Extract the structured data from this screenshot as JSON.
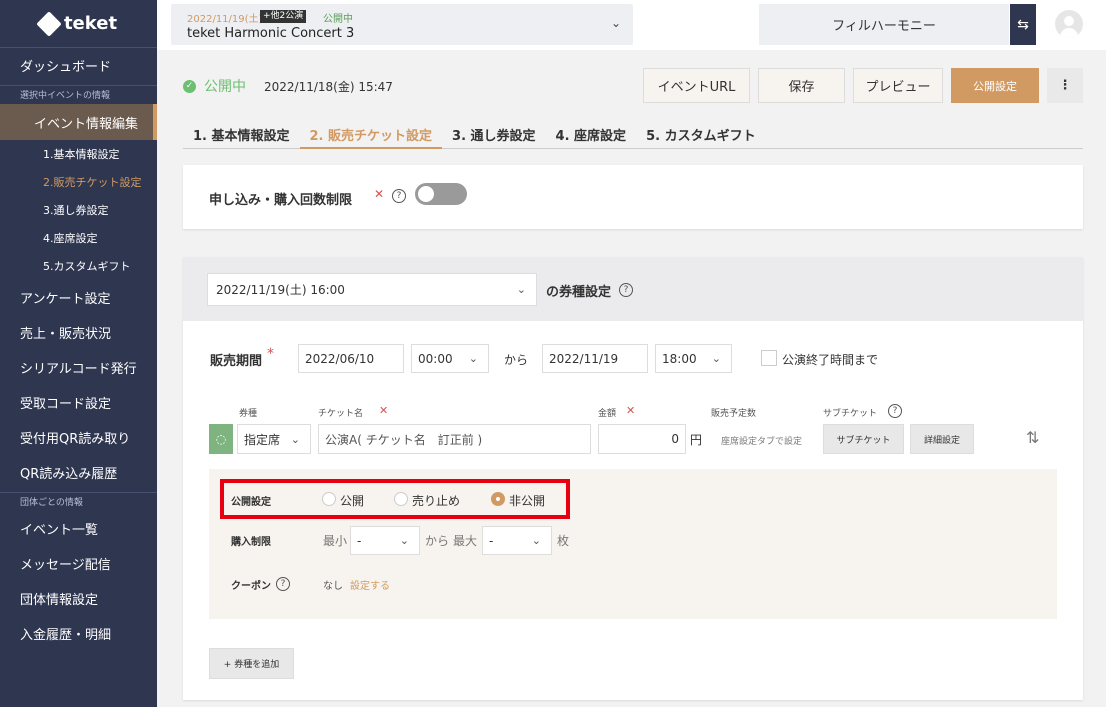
{
  "sidebar": {
    "logo_text": "teket",
    "dashboard": "ダッシュボード",
    "section_event": "選択中イベントの情報",
    "event_edit": "イベント情報編集",
    "sub_items": [
      "1.基本情報設定",
      "2.販売チケット設定",
      "3.通し券設定",
      "4.座席設定",
      "5.カスタムギフト"
    ],
    "items_a": [
      "アンケート設定",
      "売上・販売状況",
      "シリアルコード発行",
      "受取コード設定",
      "受付用QR読み取り",
      "QR読み込み履歴"
    ],
    "section_org": "団体ごとの情報",
    "items_b": [
      "イベント一覧",
      "メッセージ配信",
      "団体情報設定",
      "入金履歴・明細"
    ]
  },
  "topbar": {
    "event_date": "2022/11/19(土)",
    "event_badge": "+他2公演",
    "event_status": "公開中",
    "event_name": "teket Harmonic Concert 3",
    "org_name": "フィルハーモニー"
  },
  "status": {
    "text": "公開中",
    "datetime": "2022/11/18(金) 15:47"
  },
  "actions": {
    "event_url": "イベントURL",
    "save": "保存",
    "preview": "プレビュー",
    "publish": "公開設定",
    "more": "⋮"
  },
  "tabs": [
    "1. 基本情報設定",
    "2. 販売チケット設定",
    "3. 通し券設定",
    "4. 座席設定",
    "5. カスタムギフト"
  ],
  "limit": {
    "label": "申し込み・購入回数制限"
  },
  "ticket_type": {
    "date_select": "2022/11/19(土) 16:00",
    "heading": "の券種設定"
  },
  "sales_period": {
    "label": "販売期間",
    "start_date": "2022/06/10",
    "start_time": "00:00",
    "from": "から",
    "end_date": "2022/11/19",
    "end_time": "18:00",
    "until_end": "公演終了時間まで"
  },
  "ticket_row": {
    "col_type": "券種",
    "col_name": "チケット名",
    "col_price": "金額",
    "col_planned": "販売予定数",
    "col_sub": "サブチケット",
    "type_value": "指定席",
    "name_value": "公演A( チケット名　訂正前 )",
    "price_value": "0",
    "yen": "円",
    "planned_note": "座席設定タブで設定",
    "sub_button": "サブチケット",
    "detail_button": "詳細設定"
  },
  "detail": {
    "publish_label": "公開設定",
    "opt_public": "公開",
    "opt_stop": "売り止め",
    "opt_private": "非公開",
    "purchase_label": "購入制限",
    "min_label": "最小",
    "min_value": "-",
    "range_from": "から",
    "max_label": "最大",
    "max_value": "-",
    "unit": "枚",
    "coupon_label": "クーポン",
    "coupon_none": "なし",
    "coupon_set": "設定する"
  },
  "add_button": "+ 券種を追加",
  "colors": {
    "accent": "#d19a63",
    "sidebar": "#2f3650",
    "success": "#6cc070",
    "highlight": "#e60012"
  }
}
